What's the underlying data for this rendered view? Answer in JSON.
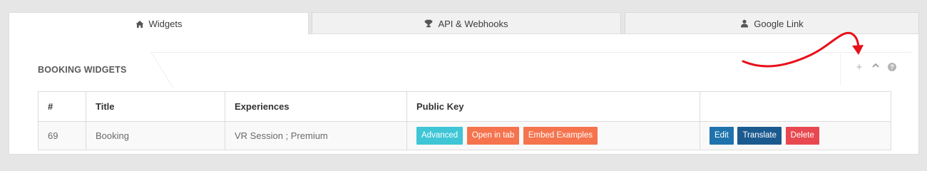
{
  "tabs": [
    {
      "label": "Widgets",
      "icon": "home-icon",
      "active": true
    },
    {
      "label": "API & Webhooks",
      "icon": "trophy-icon",
      "active": false
    },
    {
      "label": "Google Link",
      "icon": "user-icon",
      "active": false
    }
  ],
  "box": {
    "title": "BOOKING WIDGETS",
    "tools": {
      "add": "+",
      "collapse_icon": "chevron-up-icon",
      "help": "?"
    }
  },
  "table": {
    "headers": [
      "#",
      "Title",
      "Experiences",
      "Public Key",
      ""
    ],
    "rows": [
      {
        "num": "69",
        "title": "Booking",
        "experiences": "VR Session ; Premium",
        "key_buttons": [
          "Advanced",
          "Open in tab",
          "Embed Examples"
        ],
        "action_buttons": [
          "Edit",
          "Translate",
          "Delete"
        ]
      }
    ]
  },
  "colors": {
    "advanced": "#3ec6d6",
    "open_in_tab": "#f5734d",
    "embed_examples": "#f5734d",
    "edit": "#1e73ad",
    "translate": "#1b5a8f",
    "delete": "#e8484f",
    "annotation_arrow": "#e8101a"
  }
}
